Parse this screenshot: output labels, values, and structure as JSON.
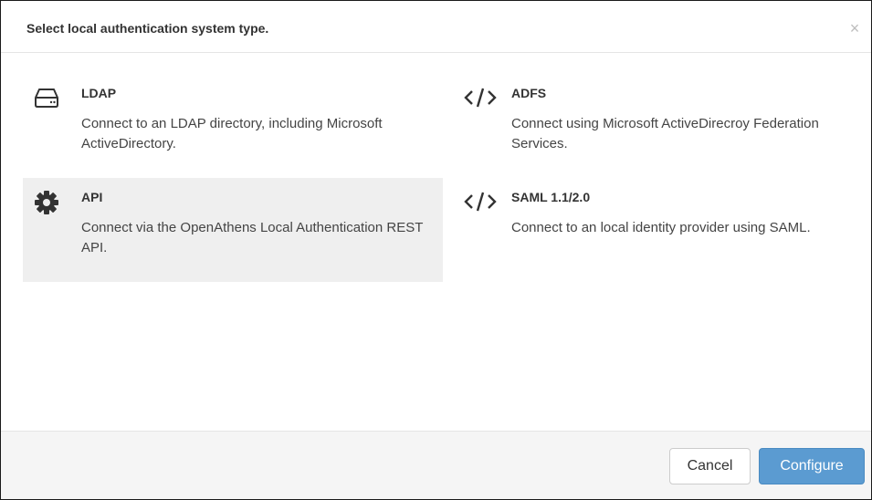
{
  "dialog": {
    "title": "Select local authentication system type.",
    "close_symbol": "×"
  },
  "options": [
    {
      "id": "ldap",
      "icon": "hard-drive-icon",
      "title": "LDAP",
      "description": "Connect to an LDAP directory, including Microsoft ActiveDirectory.",
      "selected": false
    },
    {
      "id": "adfs",
      "icon": "code-icon",
      "title": "ADFS",
      "description": "Connect using Microsoft ActiveDirecroy Federation Services.",
      "selected": false
    },
    {
      "id": "api",
      "icon": "gear-icon",
      "title": "API",
      "description": "Connect via the OpenAthens Local Authentication REST API.",
      "selected": true
    },
    {
      "id": "saml",
      "icon": "code-icon",
      "title": "SAML 1.1/2.0",
      "description": "Connect to an local identity provider using SAML.",
      "selected": false
    }
  ],
  "footer": {
    "cancel_label": "Cancel",
    "configure_label": "Configure"
  },
  "colors": {
    "primary": "#5b9bd1",
    "selected_bg": "#efefef",
    "footer_bg": "#f5f5f5"
  }
}
